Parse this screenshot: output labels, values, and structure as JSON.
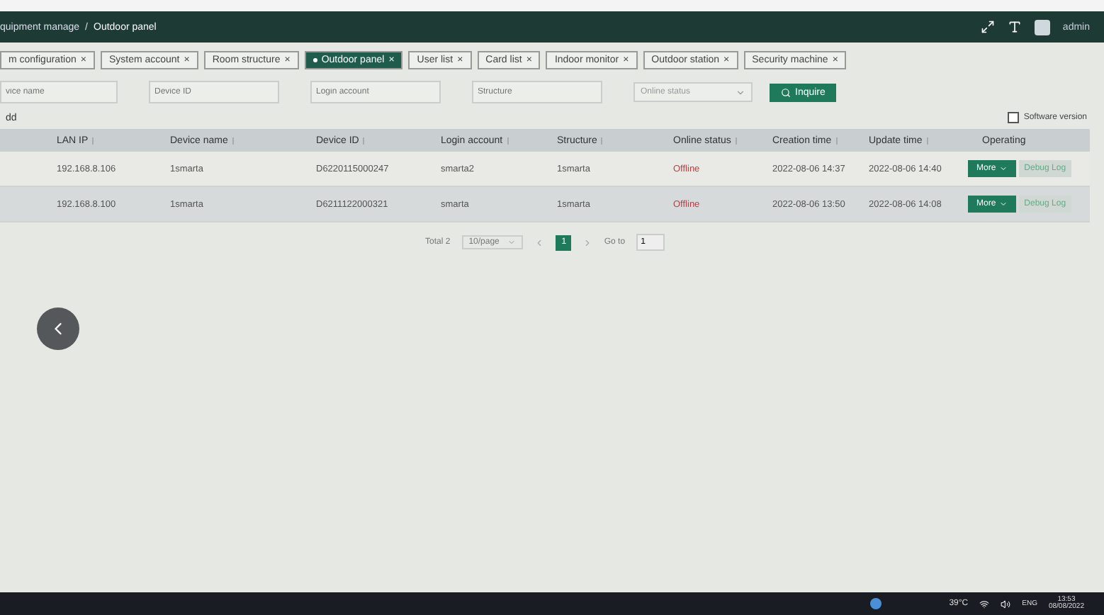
{
  "header": {
    "breadcrumb": [
      "quipment manage",
      "Outdoor panel"
    ],
    "separator": "/",
    "user": "admin"
  },
  "tabs": [
    {
      "label": "m configuration",
      "selected": false
    },
    {
      "label": "System account",
      "selected": false
    },
    {
      "label": "Room structure",
      "selected": false
    },
    {
      "label": "Outdoor panel",
      "selected": true
    },
    {
      "label": "User list",
      "selected": false
    },
    {
      "label": "Card list",
      "selected": false
    },
    {
      "label": "Indoor monitor",
      "selected": false
    },
    {
      "label": "Outdoor station",
      "selected": false
    },
    {
      "label": "Security machine",
      "selected": false
    }
  ],
  "tab_close": "×",
  "filters": [
    {
      "kind": "text",
      "placeholder": "vice name"
    },
    {
      "kind": "text",
      "placeholder": "Device ID"
    },
    {
      "kind": "text",
      "placeholder": "Login account"
    },
    {
      "kind": "text",
      "placeholder": "Structure"
    },
    {
      "kind": "select",
      "placeholder": "Online status"
    }
  ],
  "inquire_button": "Inquire",
  "add_button": "dd",
  "software_version": {
    "label": "Software version",
    "checked": false
  },
  "table": {
    "columns": [
      {
        "label": "LAN IP",
        "sortable": true
      },
      {
        "label": "Device name",
        "sortable": true
      },
      {
        "label": "Device ID",
        "sortable": true
      },
      {
        "label": "Login account",
        "sortable": true
      },
      {
        "label": "Structure",
        "sortable": true
      },
      {
        "label": "Online status",
        "sortable": true
      },
      {
        "label": "Creation time",
        "sortable": true
      },
      {
        "label": "Update time",
        "sortable": true
      },
      {
        "label": "Operating",
        "sortable": false
      }
    ],
    "rows": [
      {
        "highlighted": false,
        "cells": [
          "192.168.8.106",
          "1smarta",
          "D6220115000247",
          "smarta2",
          "1smarta",
          "Offline",
          "2022-08-06 14:37",
          "2022-08-06 14:40"
        ],
        "more": "More",
        "debug": "Debug Log"
      },
      {
        "highlighted": true,
        "cells": [
          "192.168.8.100",
          "1smarta",
          "D6211122000321",
          "smarta",
          "1smarta",
          "Offline",
          "2022-08-06 13:50",
          "2022-08-06 14:08"
        ],
        "more": "More",
        "debug": "Debug Log"
      }
    ]
  },
  "pagination": {
    "total": "Total 2",
    "page_size": "10/page",
    "pages": [
      {
        "label": "1",
        "selected": true
      }
    ],
    "goto_label": "Go to",
    "goto_value": "1"
  },
  "taskbar": {
    "weather": "39°C",
    "language": "ENG",
    "time": "13:53",
    "date": "08/08/2022"
  }
}
